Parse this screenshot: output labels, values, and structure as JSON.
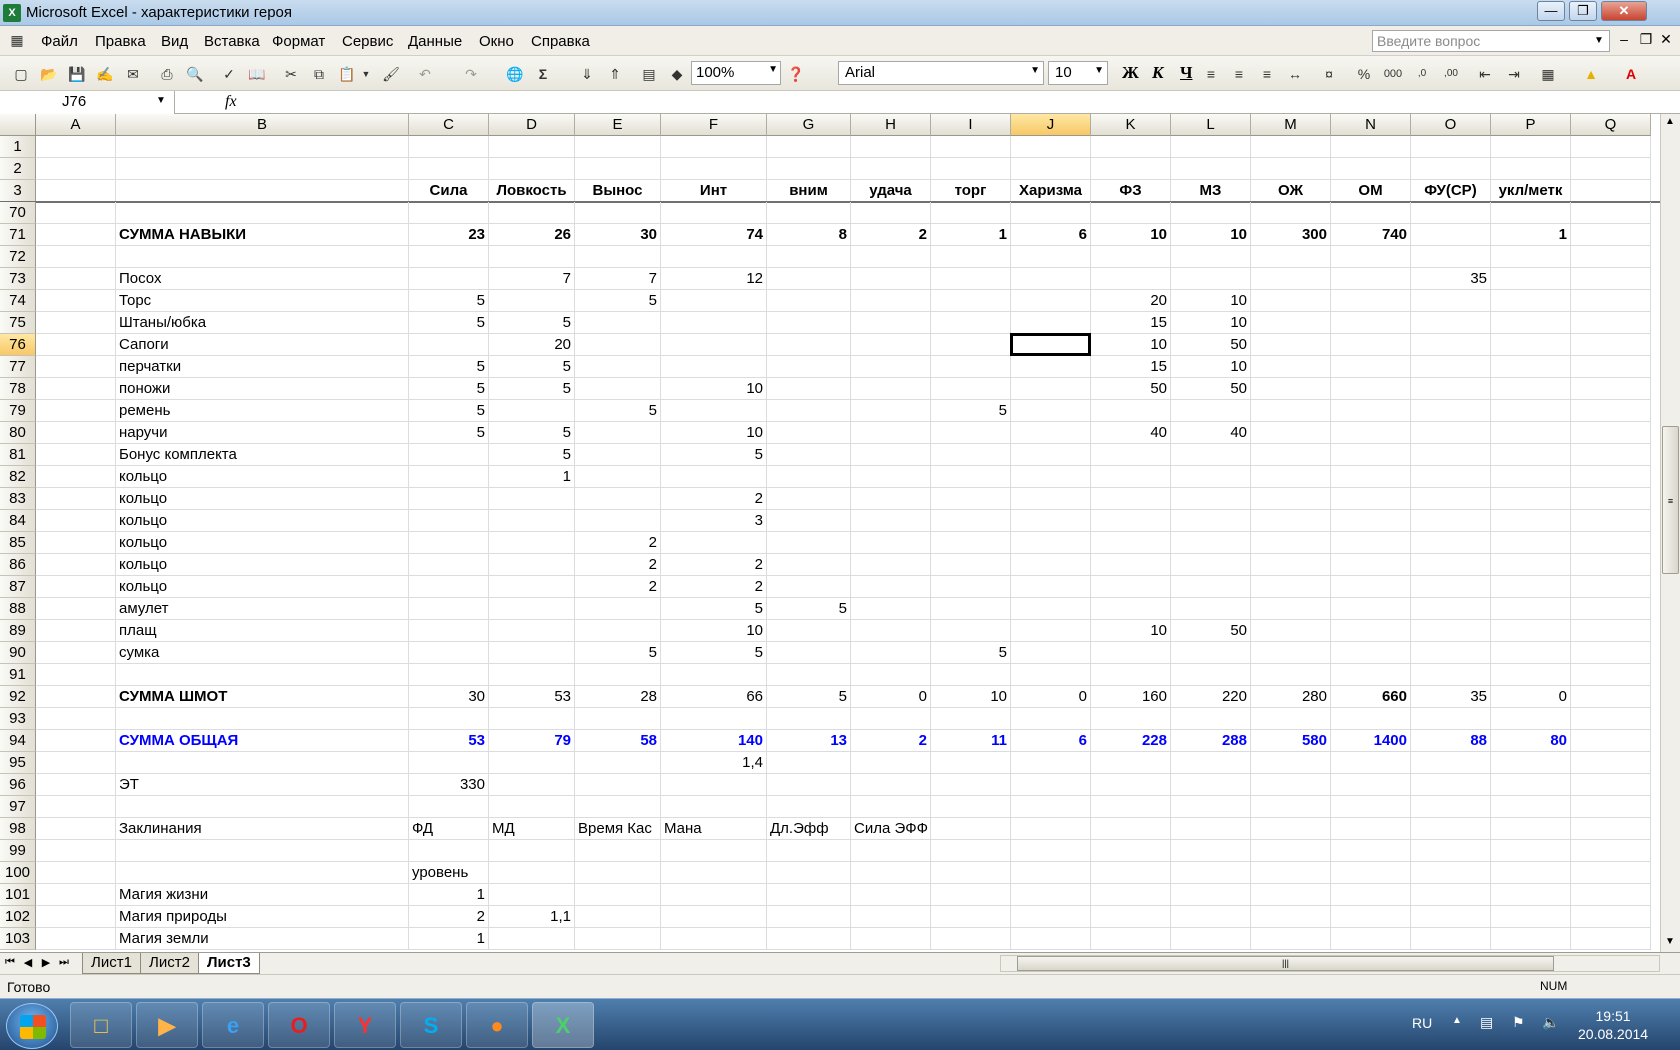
{
  "window": {
    "title": "Microsoft Excel - характеристики героя",
    "app_icon": "X"
  },
  "menu": [
    "Файл",
    "Правка",
    "Вид",
    "Вставка",
    "Формат",
    "Сервис",
    "Данные",
    "Окно",
    "Справка"
  ],
  "help": {
    "placeholder": "Введите вопрос"
  },
  "toolbar": {
    "zoom": "100%",
    "font": "Arial",
    "size": "10",
    "bold": "Ж",
    "italic": "К",
    "underline": "Ч"
  },
  "formula_bar": {
    "cell_ref": "J76",
    "fx": "fx",
    "content": ""
  },
  "columns": [
    "A",
    "B",
    "C",
    "D",
    "E",
    "F",
    "G",
    "H",
    "I",
    "J",
    "K",
    "L",
    "M",
    "N",
    "O",
    "P",
    "Q"
  ],
  "rows": [
    {
      "n": "1",
      "cells": {}
    },
    {
      "n": "2",
      "cells": {}
    },
    {
      "n": "3",
      "bold": true,
      "center": true,
      "cells": {
        "C": "Сила",
        "D": "Ловкость",
        "E": "Вынос",
        "F": "Инт",
        "G": "вним",
        "H": "удача",
        "I": "торг",
        "J": "Харизма",
        "K": "ФЗ",
        "L": "МЗ",
        "M": "ОЖ",
        "N": "ОМ",
        "O": "ФУ(СР)",
        "P": "укл/метк"
      }
    },
    {
      "n": "70",
      "cells": {}
    },
    {
      "n": "71",
      "bold": true,
      "cells": {
        "B": "СУММА НАВЫКИ",
        "C": "23",
        "D": "26",
        "E": "30",
        "F": "74",
        "G": "8",
        "H": "2",
        "I": "1",
        "J": "6",
        "K": "10",
        "L": "10",
        "M": "300",
        "N": "740",
        "P": "1"
      }
    },
    {
      "n": "72",
      "cells": {}
    },
    {
      "n": "73",
      "cells": {
        "B": "Посох",
        "D": "7",
        "E": "7",
        "F": "12",
        "O": "35"
      }
    },
    {
      "n": "74",
      "cells": {
        "B": "Торс",
        "C": "5",
        "E": "5",
        "K": "20",
        "L": "10"
      }
    },
    {
      "n": "75",
      "cells": {
        "B": "Штаны/юбка",
        "C": "5",
        "D": "5",
        "K": "15",
        "L": "10"
      }
    },
    {
      "n": "76",
      "cells": {
        "B": "Сапоги",
        "D": "20",
        "K": "10",
        "L": "50"
      }
    },
    {
      "n": "77",
      "cells": {
        "B": "перчатки",
        "C": "5",
        "D": "5",
        "K": "15",
        "L": "10"
      }
    },
    {
      "n": "78",
      "cells": {
        "B": "поножи",
        "C": "5",
        "D": "5",
        "F": "10",
        "K": "50",
        "L": "50"
      }
    },
    {
      "n": "79",
      "cells": {
        "B": "ремень",
        "C": "5",
        "E": "5",
        "I": "5"
      }
    },
    {
      "n": "80",
      "cells": {
        "B": "наручи",
        "C": "5",
        "D": "5",
        "F": "10",
        "K": "40",
        "L": "40"
      }
    },
    {
      "n": "81",
      "cells": {
        "B": "Бонус комплекта",
        "D": "5",
        "F": "5"
      }
    },
    {
      "n": "82",
      "cells": {
        "B": "кольцо",
        "D": "1"
      }
    },
    {
      "n": "83",
      "cells": {
        "B": "кольцо",
        "F": "2"
      }
    },
    {
      "n": "84",
      "cells": {
        "B": "кольцо",
        "F": "3"
      }
    },
    {
      "n": "85",
      "cells": {
        "B": "кольцо",
        "E": "2"
      }
    },
    {
      "n": "86",
      "cells": {
        "B": "кольцо",
        "E": "2",
        "F": "2"
      }
    },
    {
      "n": "87",
      "cells": {
        "B": "кольцо",
        "E": "2",
        "F": "2"
      }
    },
    {
      "n": "88",
      "cells": {
        "B": "амулет",
        "F": "5",
        "G": "5"
      }
    },
    {
      "n": "89",
      "cells": {
        "B": "плащ",
        "F": "10",
        "K": "10",
        "L": "50"
      }
    },
    {
      "n": "90",
      "cells": {
        "B": "сумка",
        "E": "5",
        "F": "5",
        "I": "5"
      }
    },
    {
      "n": "91",
      "cells": {}
    },
    {
      "n": "92",
      "boldcols": [
        "B",
        "N"
      ],
      "cells": {
        "B": "СУММА ШМОТ",
        "C": "30",
        "D": "53",
        "E": "28",
        "F": "66",
        "G": "5",
        "H": "0",
        "I": "10",
        "J": "0",
        "K": "160",
        "L": "220",
        "M": "280",
        "N": "660",
        "O": "35",
        "P": "0"
      }
    },
    {
      "n": "93",
      "cells": {}
    },
    {
      "n": "94",
      "blue": true,
      "cells": {
        "B": "СУММА ОБЩАЯ",
        "C": "53",
        "D": "79",
        "E": "58",
        "F": "140",
        "G": "13",
        "H": "2",
        "I": "11",
        "J": "6",
        "K": "228",
        "L": "288",
        "M": "580",
        "N": "1400",
        "O": "88",
        "P": "80"
      }
    },
    {
      "n": "95",
      "cells": {
        "F": "1,4"
      }
    },
    {
      "n": "96",
      "cells": {
        "B": "ЭТ",
        "C": "330"
      }
    },
    {
      "n": "97",
      "cells": {}
    },
    {
      "n": "98",
      "left": true,
      "cells": {
        "B": "Заклинания",
        "C": "ФД",
        "D": "МД",
        "E": "Время Кас",
        "F": "Мана",
        "G": "Дл.Эфф",
        "H": "Сила ЭФФ"
      }
    },
    {
      "n": "99",
      "cells": {}
    },
    {
      "n": "100",
      "left": true,
      "cells": {
        "C": "уровень"
      }
    },
    {
      "n": "101",
      "cells": {
        "B": "Магия жизни",
        "C": "1"
      }
    },
    {
      "n": "102",
      "cells": {
        "B": "Магия природы",
        "C": "2",
        "D": "1,1"
      }
    },
    {
      "n": "103",
      "cells": {
        "B": "Магия земли",
        "C": "1"
      }
    }
  ],
  "sheet_tabs": [
    "Лист1",
    "Лист2",
    "Лист3"
  ],
  "active_sheet": "Лист3",
  "status": {
    "text": "Готово",
    "num": "NUM"
  },
  "taskbar": {
    "lang": "RU",
    "time": "19:51",
    "date": "20.08.2014",
    "apps": [
      "folder-icon",
      "media-player-icon",
      "ie-icon",
      "opera-icon",
      "yandex-icon",
      "skype-icon",
      "firefox-icon",
      "excel-icon"
    ]
  },
  "colors": {
    "total_blue": "#0000ff",
    "selection_header": "#f7c866"
  }
}
